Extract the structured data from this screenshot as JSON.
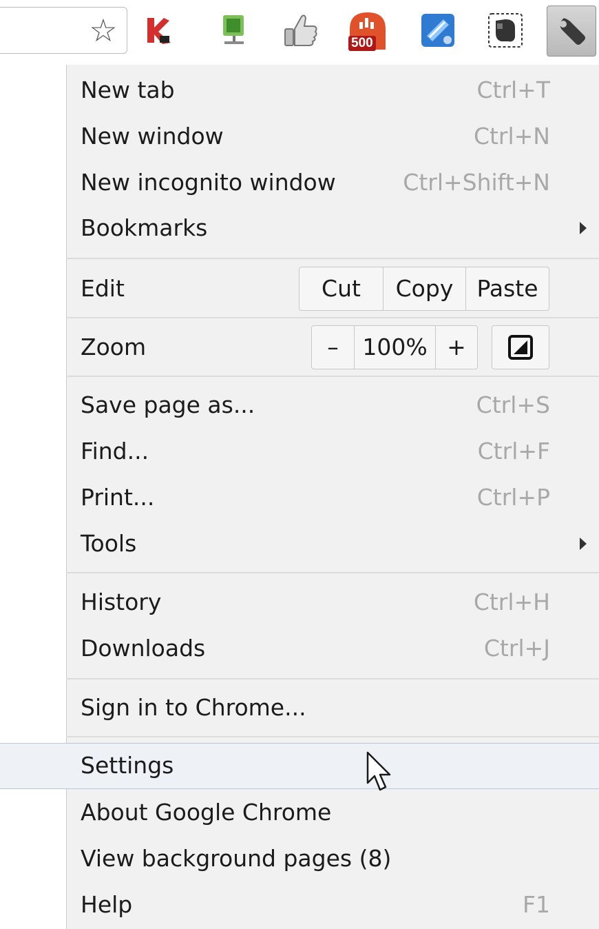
{
  "toolbar": {
    "icons": [
      {
        "name": "bookmark-star-icon",
        "glyph": "☆"
      },
      {
        "name": "kaspersky-icon"
      },
      {
        "name": "network-monitor-icon"
      },
      {
        "name": "thumbs-up-icon"
      },
      {
        "name": "500px-icon",
        "badge": "500"
      },
      {
        "name": "evernote-clipper-icon"
      },
      {
        "name": "evernote-icon"
      },
      {
        "name": "wrench-icon"
      }
    ]
  },
  "menu": {
    "new_tab": {
      "label": "New tab",
      "shortcut": "Ctrl+T"
    },
    "new_window": {
      "label": "New window",
      "shortcut": "Ctrl+N"
    },
    "new_incognito": {
      "label": "New incognito window",
      "shortcut": "Ctrl+Shift+N"
    },
    "bookmarks": {
      "label": "Bookmarks"
    },
    "edit": {
      "label": "Edit",
      "cut": "Cut",
      "copy": "Copy",
      "paste": "Paste"
    },
    "zoom": {
      "label": "Zoom",
      "minus": "–",
      "level": "100%",
      "plus": "+"
    },
    "save_page": {
      "label": "Save page as...",
      "shortcut": "Ctrl+S"
    },
    "find": {
      "label": "Find...",
      "shortcut": "Ctrl+F"
    },
    "print": {
      "label": "Print...",
      "shortcut": "Ctrl+P"
    },
    "tools": {
      "label": "Tools"
    },
    "history": {
      "label": "History",
      "shortcut": "Ctrl+H"
    },
    "downloads": {
      "label": "Downloads",
      "shortcut": "Ctrl+J"
    },
    "sign_in": {
      "label": "Sign in to Chrome..."
    },
    "settings": {
      "label": "Settings"
    },
    "about": {
      "label": "About Google Chrome"
    },
    "background_pages": {
      "label": "View background pages (8)"
    },
    "help": {
      "label": "Help",
      "shortcut": "F1"
    }
  },
  "colors": {
    "menu_bg": "#f1f1f1",
    "highlight_bg": "#eef1f6",
    "highlight_border": "#b9c7dc",
    "shortcut_text": "#a8a8a8",
    "badge_red": "#b01717"
  }
}
